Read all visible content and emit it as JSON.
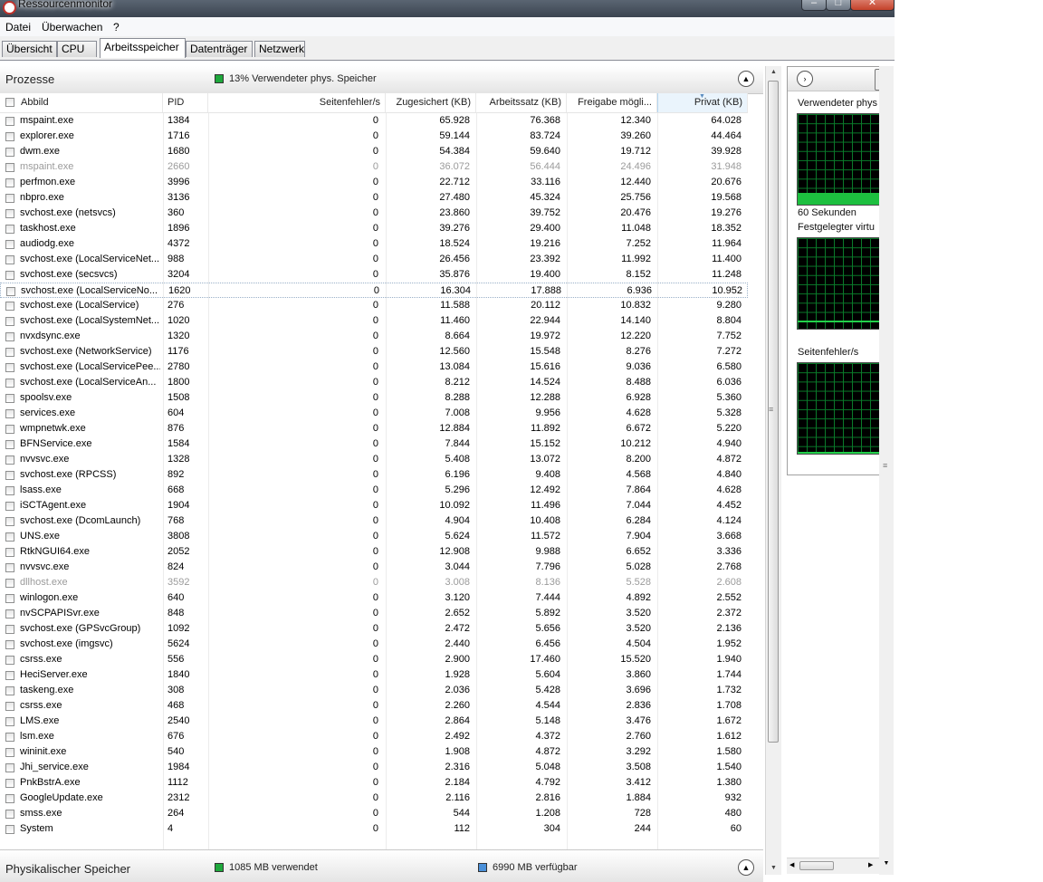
{
  "window": {
    "title": "Ressourcenmonitor",
    "minimize_glyph": "–",
    "maximize_glyph": "□",
    "close_glyph": "✕"
  },
  "menu": [
    "Datei",
    "Überwachen",
    "?"
  ],
  "tabs": [
    "Übersicht",
    "CPU",
    "Arbeitsspeicher",
    "Datenträger",
    "Netzwerk"
  ],
  "active_tab": "Arbeitsspeicher",
  "processes": {
    "title": "Prozesse",
    "legend": "13% Verwendeter phys. Speicher",
    "legend_color": "#1ea83c",
    "columns": [
      "Abbild",
      "PID",
      "Seitenfehler/s",
      "Zugesichert (KB)",
      "Arbeitssatz (KB)",
      "Freigabe mögli...",
      "Privat (KB)"
    ],
    "sorted_column": "Privat (KB)",
    "rows": [
      [
        "mspaint.exe",
        "1384",
        "0",
        "65.928",
        "76.368",
        "12.340",
        "64.028"
      ],
      [
        "explorer.exe",
        "1716",
        "0",
        "59.144",
        "83.724",
        "39.260",
        "44.464"
      ],
      [
        "dwm.exe",
        "1680",
        "0",
        "54.384",
        "59.640",
        "19.712",
        "39.928"
      ],
      [
        "mspaint.exe",
        "2660",
        "0",
        "36.072",
        "56.444",
        "24.496",
        "31.948"
      ],
      [
        "perfmon.exe",
        "3996",
        "0",
        "22.712",
        "33.116",
        "12.440",
        "20.676"
      ],
      [
        "nbpro.exe",
        "3136",
        "0",
        "27.480",
        "45.324",
        "25.756",
        "19.568"
      ],
      [
        "svchost.exe (netsvcs)",
        "360",
        "0",
        "23.860",
        "39.752",
        "20.476",
        "19.276"
      ],
      [
        "taskhost.exe",
        "1896",
        "0",
        "39.276",
        "29.400",
        "11.048",
        "18.352"
      ],
      [
        "audiodg.exe",
        "4372",
        "0",
        "18.524",
        "19.216",
        "7.252",
        "11.964"
      ],
      [
        "svchost.exe (LocalServiceNet...",
        "988",
        "0",
        "26.456",
        "23.392",
        "11.992",
        "11.400"
      ],
      [
        "svchost.exe (secsvcs)",
        "3204",
        "0",
        "35.876",
        "19.400",
        "8.152",
        "11.248"
      ],
      [
        "svchost.exe (LocalServiceNo...",
        "1620",
        "0",
        "16.304",
        "17.888",
        "6.936",
        "10.952"
      ],
      [
        "svchost.exe (LocalService)",
        "276",
        "0",
        "11.588",
        "20.112",
        "10.832",
        "9.280"
      ],
      [
        "svchost.exe (LocalSystemNet...",
        "1020",
        "0",
        "11.460",
        "22.944",
        "14.140",
        "8.804"
      ],
      [
        "nvxdsync.exe",
        "1320",
        "0",
        "8.664",
        "19.972",
        "12.220",
        "7.752"
      ],
      [
        "svchost.exe (NetworkService)",
        "1176",
        "0",
        "12.560",
        "15.548",
        "8.276",
        "7.272"
      ],
      [
        "svchost.exe (LocalServicePee...",
        "2780",
        "0",
        "13.084",
        "15.616",
        "9.036",
        "6.580"
      ],
      [
        "svchost.exe (LocalServiceAn...",
        "1800",
        "0",
        "8.212",
        "14.524",
        "8.488",
        "6.036"
      ],
      [
        "spoolsv.exe",
        "1508",
        "0",
        "8.288",
        "12.288",
        "6.928",
        "5.360"
      ],
      [
        "services.exe",
        "604",
        "0",
        "7.008",
        "9.956",
        "4.628",
        "5.328"
      ],
      [
        "wmpnetwk.exe",
        "876",
        "0",
        "12.884",
        "11.892",
        "6.672",
        "5.220"
      ],
      [
        "BFNService.exe",
        "1584",
        "0",
        "7.844",
        "15.152",
        "10.212",
        "4.940"
      ],
      [
        "nvvsvc.exe",
        "1328",
        "0",
        "5.408",
        "13.072",
        "8.200",
        "4.872"
      ],
      [
        "svchost.exe (RPCSS)",
        "892",
        "0",
        "6.196",
        "9.408",
        "4.568",
        "4.840"
      ],
      [
        "lsass.exe",
        "668",
        "0",
        "5.296",
        "12.492",
        "7.864",
        "4.628"
      ],
      [
        "iSCTAgent.exe",
        "1904",
        "0",
        "10.092",
        "11.496",
        "7.044",
        "4.452"
      ],
      [
        "svchost.exe (DcomLaunch)",
        "768",
        "0",
        "4.904",
        "10.408",
        "6.284",
        "4.124"
      ],
      [
        "UNS.exe",
        "3808",
        "0",
        "5.624",
        "11.572",
        "7.904",
        "3.668"
      ],
      [
        "RtkNGUI64.exe",
        "2052",
        "0",
        "12.908",
        "9.988",
        "6.652",
        "3.336"
      ],
      [
        "nvvsvc.exe",
        "824",
        "0",
        "3.044",
        "7.796",
        "5.028",
        "2.768"
      ],
      [
        "dllhost.exe",
        "3592",
        "0",
        "3.008",
        "8.136",
        "5.528",
        "2.608"
      ],
      [
        "winlogon.exe",
        "640",
        "0",
        "3.120",
        "7.444",
        "4.892",
        "2.552"
      ],
      [
        "nvSCPAPISvr.exe",
        "848",
        "0",
        "2.652",
        "5.892",
        "3.520",
        "2.372"
      ],
      [
        "svchost.exe (GPSvcGroup)",
        "1092",
        "0",
        "2.472",
        "5.656",
        "3.520",
        "2.136"
      ],
      [
        "svchost.exe (imgsvc)",
        "5624",
        "0",
        "2.440",
        "6.456",
        "4.504",
        "1.952"
      ],
      [
        "csrss.exe",
        "556",
        "0",
        "2.900",
        "17.460",
        "15.520",
        "1.940"
      ],
      [
        "HeciServer.exe",
        "1840",
        "0",
        "1.928",
        "5.604",
        "3.860",
        "1.744"
      ],
      [
        "taskeng.exe",
        "308",
        "0",
        "2.036",
        "5.428",
        "3.696",
        "1.732"
      ],
      [
        "csrss.exe",
        "468",
        "0",
        "2.260",
        "4.544",
        "2.836",
        "1.708"
      ],
      [
        "LMS.exe",
        "2540",
        "0",
        "2.864",
        "5.148",
        "3.476",
        "1.672"
      ],
      [
        "lsm.exe",
        "676",
        "0",
        "2.492",
        "4.372",
        "2.760",
        "1.612"
      ],
      [
        "wininit.exe",
        "540",
        "0",
        "1.908",
        "4.872",
        "3.292",
        "1.580"
      ],
      [
        "Jhi_service.exe",
        "1984",
        "0",
        "2.316",
        "5.048",
        "3.508",
        "1.540"
      ],
      [
        "PnkBstrA.exe",
        "1112",
        "0",
        "2.184",
        "4.792",
        "3.412",
        "1.380"
      ],
      [
        "GoogleUpdate.exe",
        "2312",
        "0",
        "2.116",
        "2.816",
        "1.884",
        "932"
      ],
      [
        "smss.exe",
        "264",
        "0",
        "544",
        "1.208",
        "728",
        "480"
      ],
      [
        "System",
        "4",
        "0",
        "112",
        "304",
        "244",
        "60"
      ]
    ],
    "dimmed_rows": [
      3,
      30
    ],
    "selected_row": 11
  },
  "physical_memory": {
    "title": "Physikalischer Speicher",
    "used_label": "1085 MB verwendet",
    "used_color": "#1ea83c",
    "available_label": "6990 MB verfügbar",
    "available_color": "#4a90d9"
  },
  "graphs": {
    "used_physical_title": "Verwendeter phys",
    "used_physical_level": 0.13,
    "time_label": "60 Sekunden",
    "committed_virtual_title": "Festgelegter virtu",
    "committed_virtual_level": 0.07,
    "hard_faults_title": "Seitenfehler/s",
    "hard_faults_level": 0.0
  },
  "colors": {
    "graph_bg": "#000000",
    "graph_grid": "#0a7a2a",
    "graph_fill": "#1dbf3f"
  }
}
